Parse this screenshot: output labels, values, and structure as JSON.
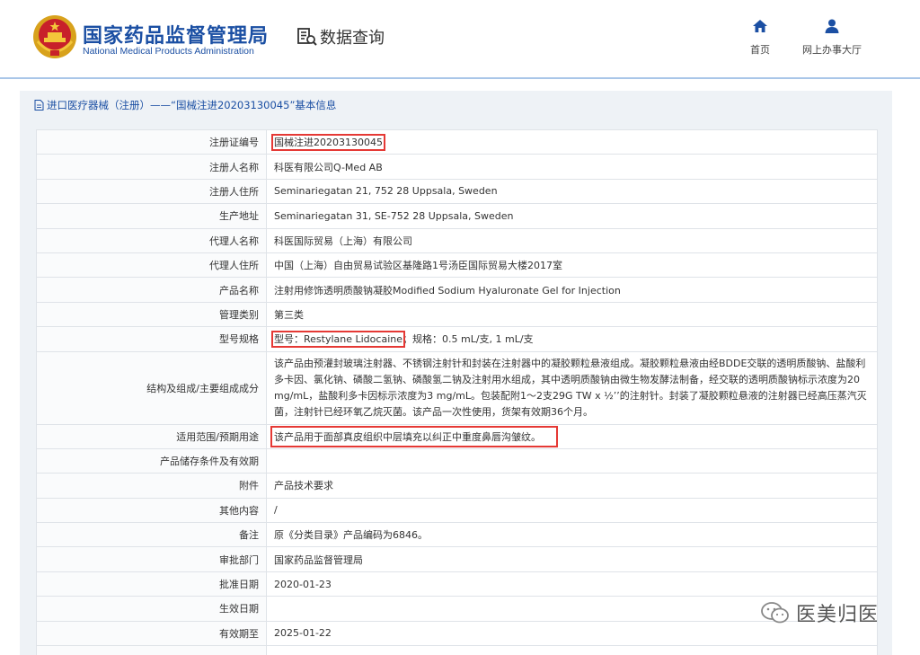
{
  "header": {
    "brand_cn": "国家药品监督管理局",
    "brand_en": "National Medical Products Administration",
    "query_label": "数据查询",
    "nav": [
      {
        "label": "首页",
        "icon": "home-icon"
      },
      {
        "label": "网上办事大厅",
        "icon": "user-icon"
      }
    ]
  },
  "panel": {
    "title": "进口医疗器械（注册）——“国械注进20203130045”基本信息"
  },
  "rows": [
    {
      "label": "注册证编号",
      "value": "国械注进20203130045"
    },
    {
      "label": "注册人名称",
      "value": "科医有限公司Q-Med AB"
    },
    {
      "label": "注册人住所",
      "value": "Seminariegatan 21, 752 28 Uppsala, Sweden"
    },
    {
      "label": "生产地址",
      "value": "Seminariegatan 31, SE-752 28 Uppsala, Sweden"
    },
    {
      "label": "代理人名称",
      "value": "科医国际贸易（上海）有限公司"
    },
    {
      "label": "代理人住所",
      "value": "中国（上海）自由贸易试验区基隆路1号汤臣国际贸易大楼2017室"
    },
    {
      "label": "产品名称",
      "value": "注射用修饰透明质酸钠凝胶Modified Sodium Hyaluronate Gel for Injection"
    },
    {
      "label": "管理类别",
      "value": "第三类"
    },
    {
      "label": "型号规格",
      "value_model": "型号：Restylane Lidocaine",
      "value_spec": "；规格：0.5 mL/支, 1 mL/支"
    },
    {
      "label": "结构及组成/主要组成成分",
      "value": "该产品由预灌封玻璃注射器、不锈钢注射针和封装在注射器中的凝胶颗粒悬液组成。凝胶颗粒悬液由经BDDE交联的透明质酸钠、盐酸利多卡因、氯化钠、磷酸二氢钠、磷酸氢二钠及注射用水组成，其中透明质酸钠由微生物发酵法制备，经交联的透明质酸钠标示浓度为20 mg/mL，盐酸利多卡因标示浓度为3 mg/mL。包装配附1～2支29G TW x ½’’的注射针。封装了凝胶颗粒悬液的注射器已经高压蒸汽灭菌，注射针已经环氧乙烷灭菌。该产品一次性使用，货架有效期36个月。"
    },
    {
      "label": "适用范围/预期用途",
      "value": "该产品用于面部真皮组织中层填充以纠正中重度鼻唇沟皱纹。"
    },
    {
      "label": "产品储存条件及有效期",
      "value": ""
    },
    {
      "label": "附件",
      "value": "产品技术要求"
    },
    {
      "label": "其他内容",
      "value": "/"
    },
    {
      "label": "备注",
      "value": "原《分类目录》产品编码为6846。"
    },
    {
      "label": "审批部门",
      "value": "国家药品监督管理局"
    },
    {
      "label": "批准日期",
      "value": "2020-01-23"
    },
    {
      "label": "生效日期",
      "value": ""
    },
    {
      "label": "有效期至",
      "value": "2025-01-22"
    }
  ],
  "watermark": "医美归医",
  "colors": {
    "brand_blue": "#1b4fa3",
    "highlight_red": "#e53935",
    "panel_bg": "#eef2f6"
  }
}
